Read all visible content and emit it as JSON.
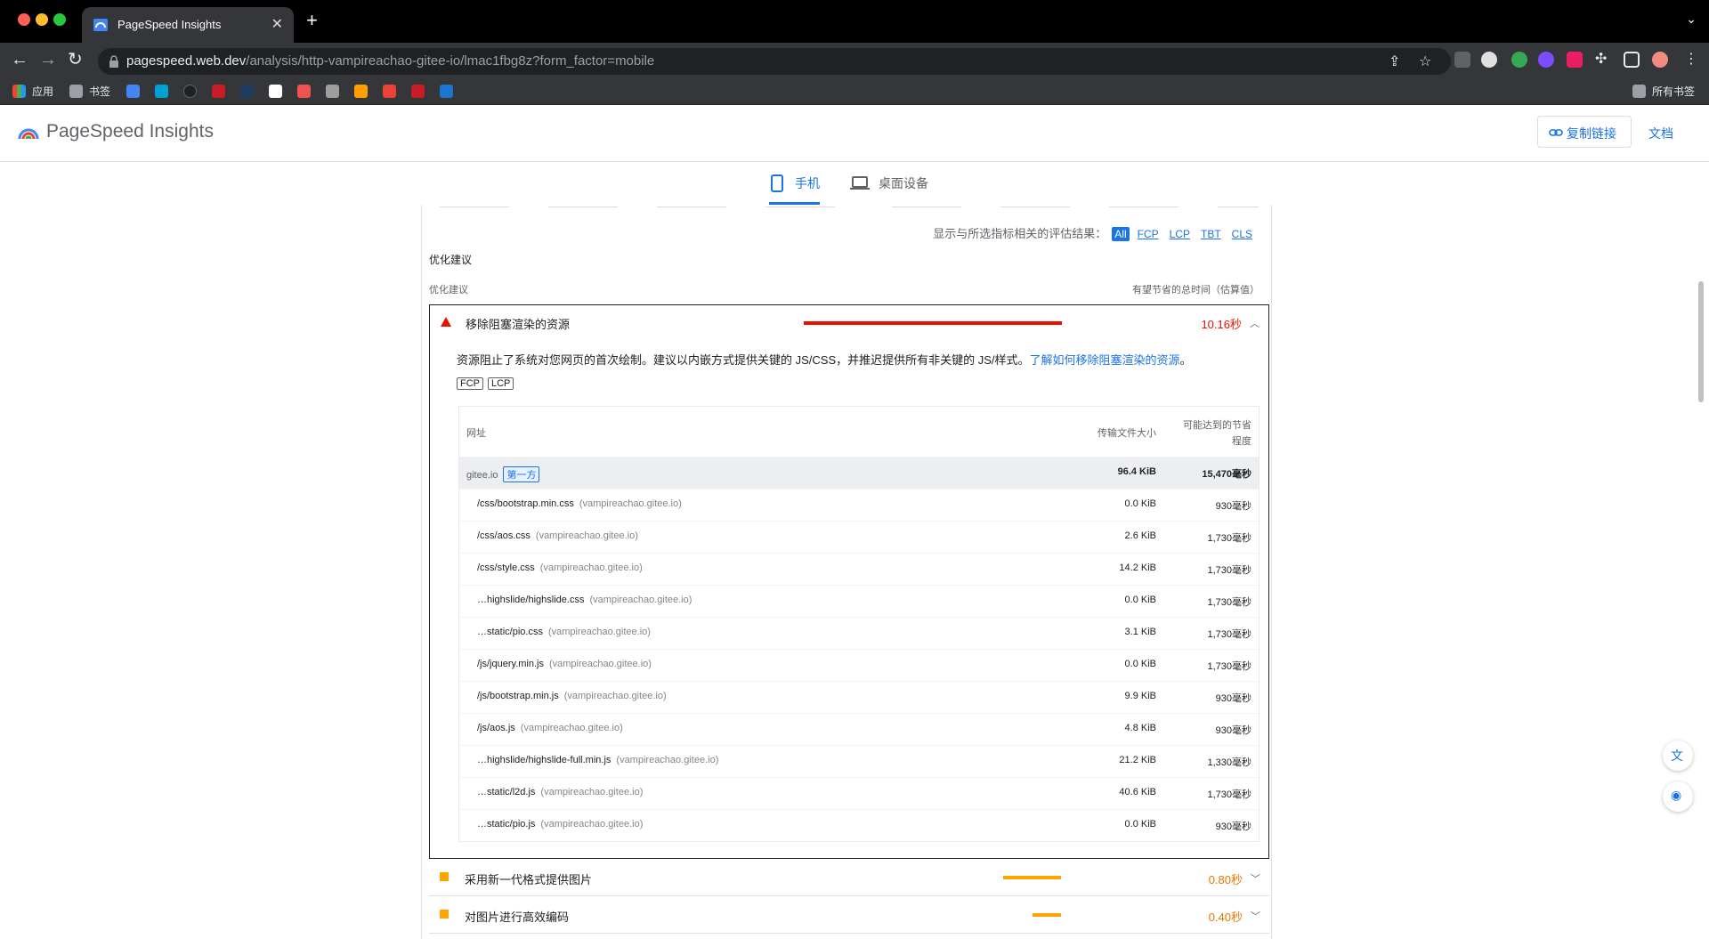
{
  "browser": {
    "tab_title": "PageSpeed Insights",
    "url_host": "pagespeed.web.dev",
    "url_path": "/analysis/http-vampireachao-gitee-io/lmac1fbg8z?form_factor=mobile",
    "bookmarks": {
      "apps_label": "应用",
      "folder_label": "书签",
      "all_bookmarks_label": "所有书签"
    }
  },
  "header": {
    "brand": "PageSpeed Insights",
    "copy_link_label": "复制链接",
    "docs_label": "文档"
  },
  "device_tabs": {
    "mobile_label": "手机",
    "desktop_label": "桌面设备"
  },
  "filter": {
    "label": "显示与所选指标相关的评估结果：",
    "chips": [
      "All",
      "FCP",
      "LCP",
      "TBT",
      "CLS"
    ]
  },
  "section": {
    "title": "优化建议",
    "col_left": "优化建议",
    "col_right": "有望节省的总时间（估算值）"
  },
  "audit_open": {
    "title": "移除阻塞渲染的资源",
    "value": "10.16秒",
    "description": "资源阻止了系统对您网页的首次绘制。建议以内嵌方式提供关键的 JS/CSS，并推迟提供所有非关键的 JS/样式。",
    "learn_more": "了解如何移除阻塞渲染的资源",
    "desc_end": "。",
    "tags": [
      "FCP",
      "LCP"
    ],
    "table": {
      "col_url": "网址",
      "col_size": "传输文件大小",
      "col_savings_1": "可能达到的节省",
      "col_savings_2": "程度",
      "group": {
        "host": "gitee.io",
        "badge": "第一方",
        "size": "96.4 KiB",
        "savings": "15,470毫秒"
      },
      "rows": [
        {
          "url": "/css/bootstrap.min.css",
          "host": "(vampireachao.gitee.io)",
          "size": "0.0 KiB",
          "savings": "930毫秒"
        },
        {
          "url": "/css/aos.css",
          "host": "(vampireachao.gitee.io)",
          "size": "2.6 KiB",
          "savings": "1,730毫秒"
        },
        {
          "url": "/css/style.css",
          "host": "(vampireachao.gitee.io)",
          "size": "14.2 KiB",
          "savings": "1,730毫秒"
        },
        {
          "url": "…highslide/highslide.css",
          "host": "(vampireachao.gitee.io)",
          "size": "0.0 KiB",
          "savings": "1,730毫秒"
        },
        {
          "url": "…static/pio.css",
          "host": "(vampireachao.gitee.io)",
          "size": "3.1 KiB",
          "savings": "1,730毫秒"
        },
        {
          "url": "/js/jquery.min.js",
          "host": "(vampireachao.gitee.io)",
          "size": "0.0 KiB",
          "savings": "1,730毫秒"
        },
        {
          "url": "/js/bootstrap.min.js",
          "host": "(vampireachao.gitee.io)",
          "size": "9.9 KiB",
          "savings": "930毫秒"
        },
        {
          "url": "/js/aos.js",
          "host": "(vampireachao.gitee.io)",
          "size": "4.8 KiB",
          "savings": "930毫秒"
        },
        {
          "url": "…highslide/highslide-full.min.js",
          "host": "(vampireachao.gitee.io)",
          "size": "21.2 KiB",
          "savings": "1,330毫秒"
        },
        {
          "url": "…static/l2d.js",
          "host": "(vampireachao.gitee.io)",
          "size": "40.6 KiB",
          "savings": "1,730毫秒"
        },
        {
          "url": "…static/pio.js",
          "host": "(vampireachao.gitee.io)",
          "size": "0.0 KiB",
          "savings": "930毫秒"
        }
      ]
    },
    "bar_fraction": 1.0
  },
  "audits_collapsed": [
    {
      "title": "采用新一代格式提供图片",
      "value": "0.80秒",
      "bar_fraction": 0.08
    },
    {
      "title": "对图片进行高效编码",
      "value": "0.40秒",
      "bar_fraction": 0.04
    }
  ],
  "colors": {
    "fail": "#eb0f00",
    "average": "#ffa400",
    "accent": "#1a73e8"
  }
}
